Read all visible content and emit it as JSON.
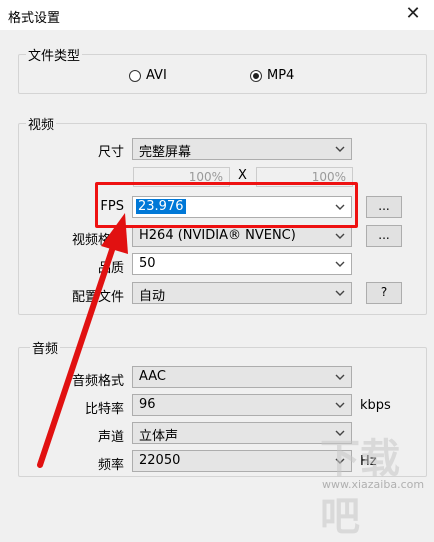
{
  "window": {
    "title": "格式设置",
    "close_icon": "close-icon"
  },
  "file_type": {
    "legend": "文件类型",
    "options": [
      {
        "label": "AVI",
        "selected": false
      },
      {
        "label": "MP4",
        "selected": true
      }
    ]
  },
  "video": {
    "legend": "视频",
    "size": {
      "label": "尺寸",
      "value": "完整屏幕",
      "width": "100%",
      "height": "100%",
      "x_sep": "X"
    },
    "fps": {
      "label": "FPS",
      "value": "23.976",
      "more": "..."
    },
    "format": {
      "label": "视频格式",
      "value": "H264 (NVIDIA® NVENC)",
      "more": "..."
    },
    "quality": {
      "label": "品质",
      "value": "50"
    },
    "profile": {
      "label": "配置文件",
      "value": "自动",
      "help": "?"
    }
  },
  "audio": {
    "legend": "音频",
    "format": {
      "label": "音频格式",
      "value": "AAC"
    },
    "bitrate": {
      "label": "比特率",
      "value": "96",
      "unit": "kbps"
    },
    "channels": {
      "label": "声道",
      "value": "立体声"
    },
    "samplerate": {
      "label": "频率",
      "value": "22050",
      "unit": "Hz"
    }
  },
  "watermark": {
    "main": "下载吧",
    "url": "www.xiazaiba.com"
  },
  "accent": {
    "highlight": "#e11111",
    "selection": "#0078d7"
  }
}
